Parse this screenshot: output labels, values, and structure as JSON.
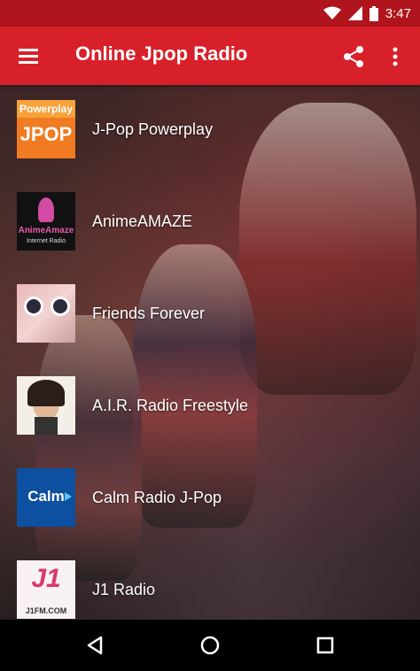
{
  "status_bar": {
    "time": "3:47"
  },
  "app_bar": {
    "title": "Online Jpop Radio"
  },
  "stations": [
    {
      "name": "J-Pop Powerplay",
      "logo_top": "Powerplay",
      "logo_bottom": "JPOP"
    },
    {
      "name": "AnimeAMAZE",
      "logo_top": "AnimeAmaze",
      "logo_bottom": "Internet Radio"
    },
    {
      "name": "Friends Forever"
    },
    {
      "name": "A.I.R. Radio Freestyle"
    },
    {
      "name": "Calm Radio J-Pop",
      "logo_top": "Calm"
    },
    {
      "name": "J1 Radio",
      "logo_top": "J1",
      "logo_bottom": "J1FM.COM"
    }
  ],
  "colors": {
    "status_bar": "#b0141c",
    "app_bar": "#d8202a"
  }
}
